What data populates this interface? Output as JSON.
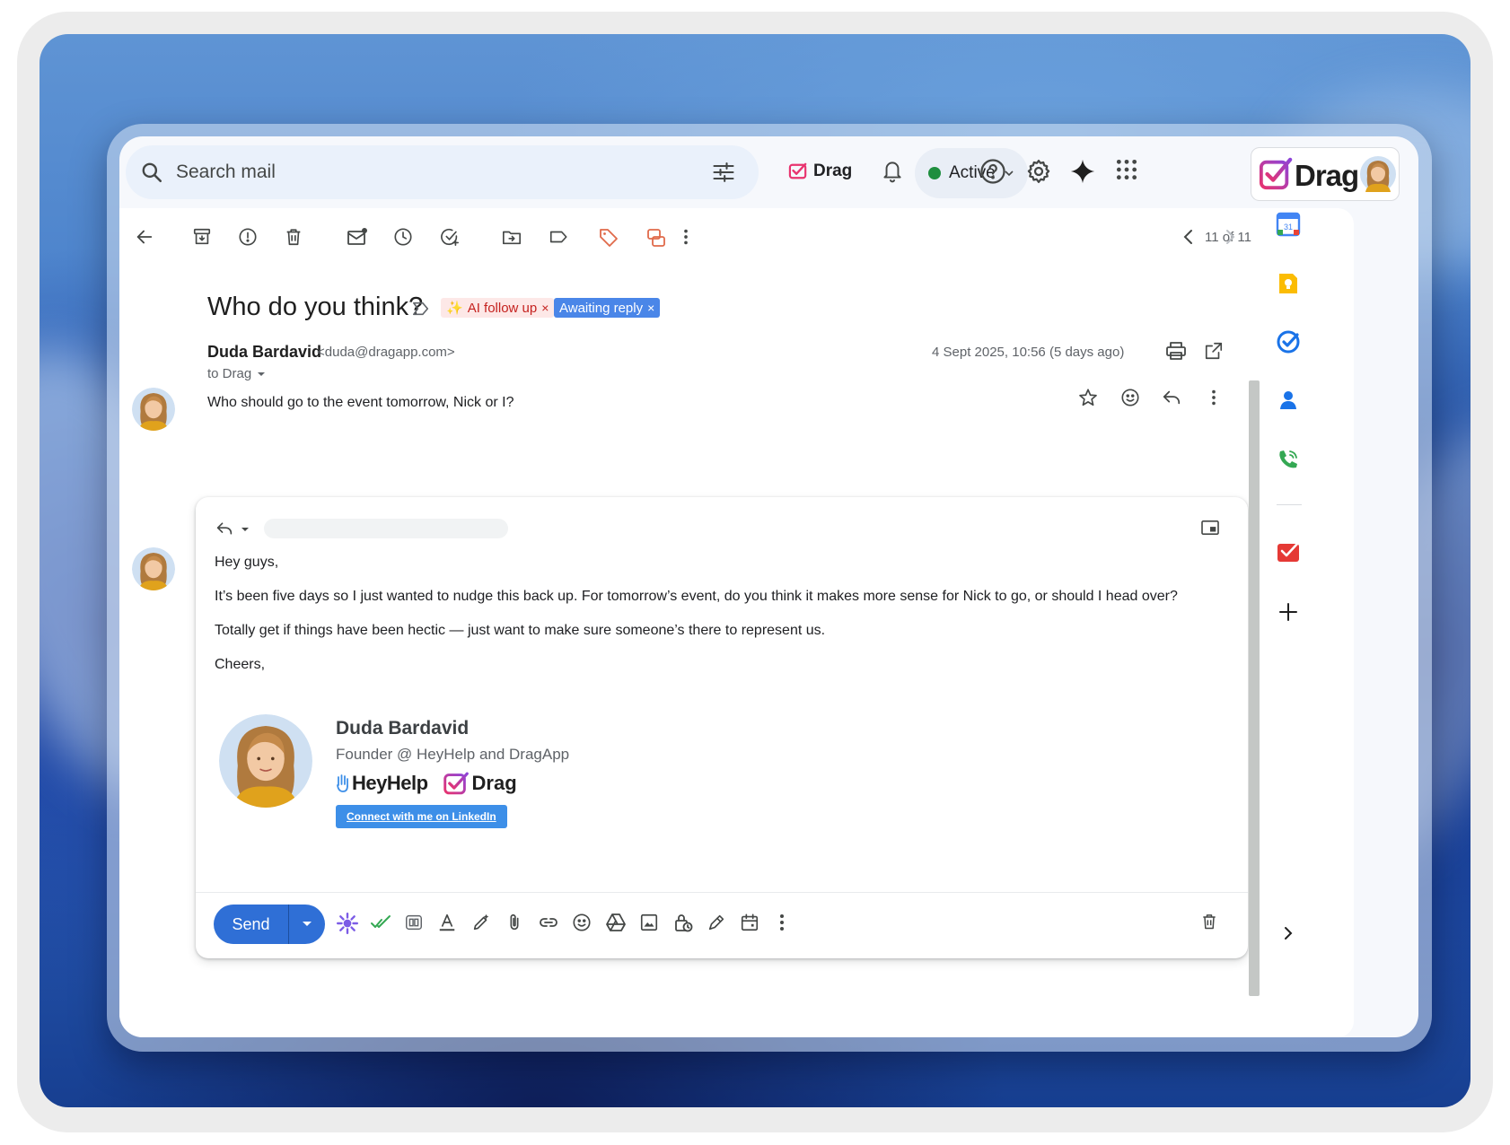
{
  "search": {
    "placeholder": "Search mail"
  },
  "header": {
    "drag_label": "Drag",
    "status_label": "Active",
    "brand_label": "Drag"
  },
  "toolbar": {
    "pager": "11 of 11"
  },
  "thread": {
    "subject": "Who do you think?",
    "labels": {
      "ai_follow_up": "AI follow up",
      "awaiting_reply": "Awaiting reply",
      "remove": "×"
    }
  },
  "message": {
    "sender_name": "Duda Bardavid",
    "sender_email": "<duda@dragapp.com>",
    "to": "to Drag",
    "date": "4 Sept 2025, 10:56 (5 days ago)",
    "body": "Who should go to the event tomorrow, Nick or I?"
  },
  "reply": {
    "greeting": "Hey guys,",
    "paragraph1": "It’s been five days so I just wanted to nudge this back up. For tomorrow’s event, do you think it makes more sense for Nick to go, or should I head over?",
    "paragraph2": "Totally get if things have been hectic — just want to make sure someone’s there to represent us.",
    "closing": "Cheers,",
    "signature": {
      "name": "Duda Bardavid",
      "title": "Founder @ HeyHelp and DragApp",
      "logo_heyhelp": "HeyHelp",
      "logo_drag": "Drag",
      "linkedin": "Connect with me on LinkedIn"
    },
    "send_label": "Send"
  },
  "side_panel": {
    "calendar_day": "31"
  },
  "colors": {
    "accent_blue": "#2f6fd6",
    "awaiting_chip": "#4a86e8",
    "ai_chip_text": "#c5221f",
    "active_dot": "#1e8e3e",
    "drag_pink": "#e8336f",
    "drag_purple": "#8e44d8"
  }
}
